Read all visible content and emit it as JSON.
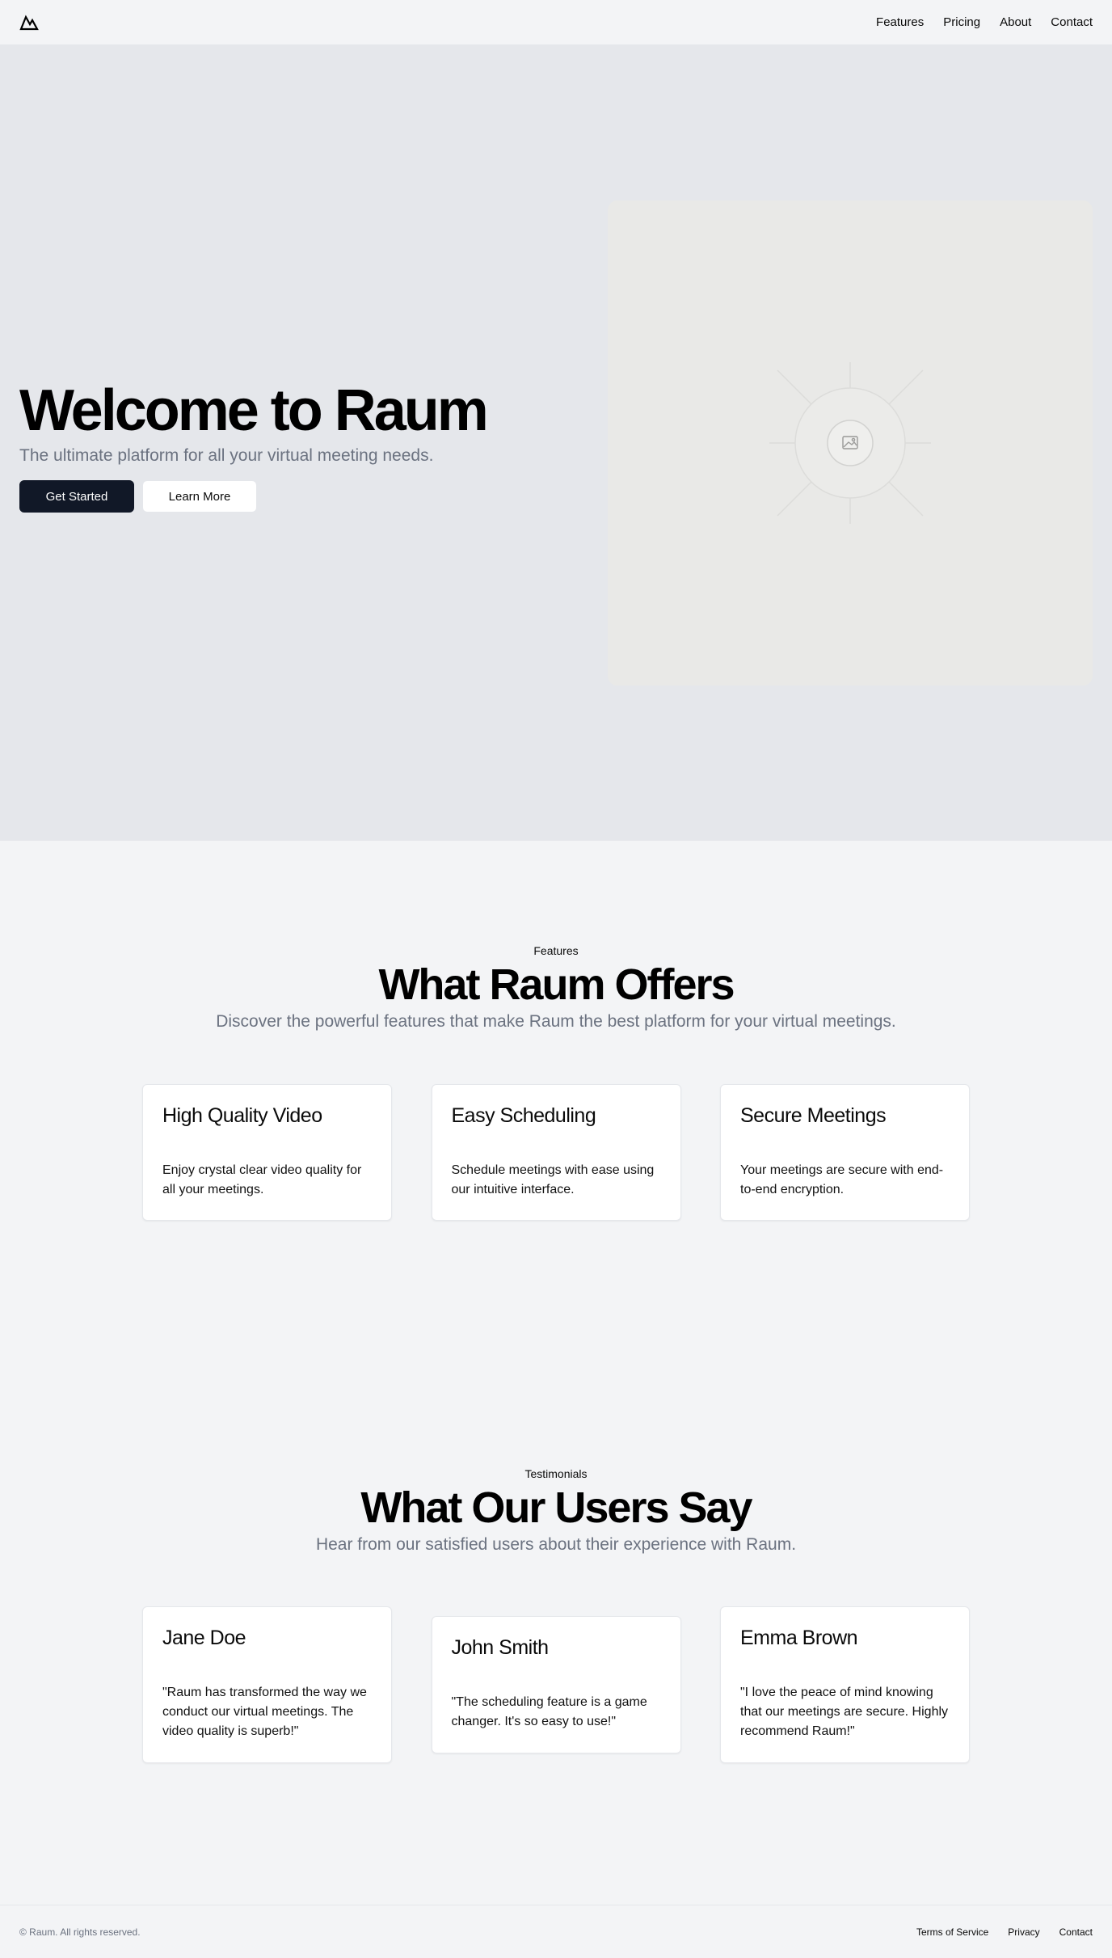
{
  "header": {
    "logo_icon": "mountain-icon",
    "nav": [
      "Features",
      "Pricing",
      "About",
      "Contact"
    ]
  },
  "hero": {
    "title": "Welcome to Raum",
    "subtitle": "The ultimate platform for all your virtual meeting needs.",
    "primary_button": "Get Started",
    "secondary_button": "Learn More",
    "image_icon": "image-placeholder-icon"
  },
  "features": {
    "eyebrow": "Features",
    "title": "What Raum Offers",
    "subtitle": "Discover the powerful features that make Raum the best platform for your virtual meetings.",
    "cards": [
      {
        "title": "High Quality Video",
        "body": "Enjoy crystal clear video quality for all your meetings."
      },
      {
        "title": "Easy Scheduling",
        "body": "Schedule meetings with ease using our intuitive interface."
      },
      {
        "title": "Secure Meetings",
        "body": "Your meetings are secure with end-to-end encryption."
      }
    ]
  },
  "testimonials": {
    "eyebrow": "Testimonials",
    "title": "What Our Users Say",
    "subtitle": "Hear from our satisfied users about their experience with Raum.",
    "cards": [
      {
        "name": "Jane Doe",
        "quote": "\"Raum has transformed the way we conduct our virtual meetings. The video quality is superb!\""
      },
      {
        "name": "John Smith",
        "quote": "\"The scheduling feature is a game changer. It's so easy to use!\""
      },
      {
        "name": "Emma Brown",
        "quote": "\"I love the peace of mind knowing that our meetings are secure. Highly recommend Raum!\""
      }
    ]
  },
  "footer": {
    "copyright": "© Raum. All rights reserved.",
    "links": [
      "Terms of Service",
      "Privacy",
      "Contact"
    ]
  },
  "colors": {
    "primary": "#111827",
    "page_bg": "#f3f4f6",
    "hero_bg": "#e5e7eb",
    "muted_text": "#6b7280"
  }
}
